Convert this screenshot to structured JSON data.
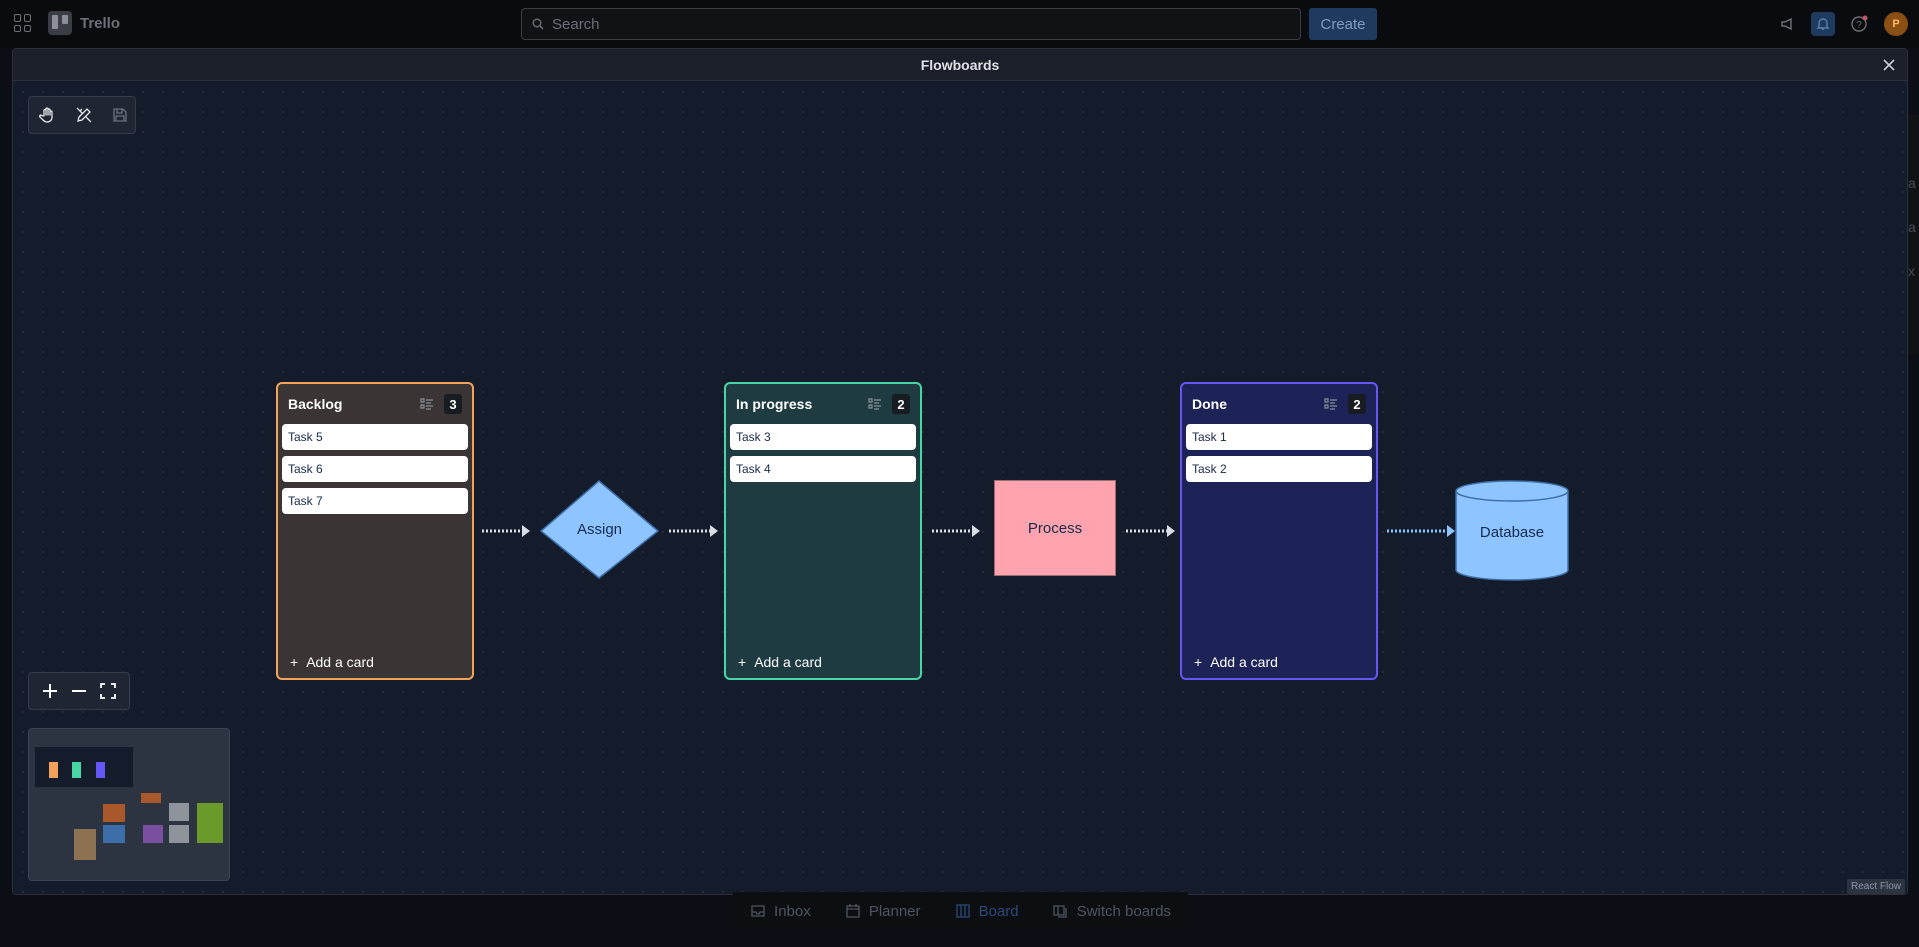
{
  "app": {
    "name": "Trello",
    "search_placeholder": "Search",
    "create_label": "Create",
    "avatar_initial": "P"
  },
  "modal": {
    "title": "Flowboards",
    "close_icon": "close-icon"
  },
  "toolbar": {
    "tools": [
      "hand-icon",
      "pen-ruler-icon",
      "save-icon"
    ]
  },
  "columns": [
    {
      "title": "Backlog",
      "count": "3",
      "cards": [
        "Task 5",
        "Task 6",
        "Task 7"
      ],
      "add_label": "Add a card",
      "color": "#f5a35b",
      "bg": "#3a3534"
    },
    {
      "title": "In progress",
      "count": "2",
      "cards": [
        "Task 3",
        "Task 4"
      ],
      "add_label": "Add a card",
      "color": "#49d6a5",
      "bg": "#1e3b42"
    },
    {
      "title": "Done",
      "count": "2",
      "cards": [
        "Task 1",
        "Task 2"
      ],
      "add_label": "Add a card",
      "color": "#6557f5",
      "bg": "#1d2257"
    }
  ],
  "shapes": {
    "assign": "Assign",
    "process": "Process",
    "database": "Database"
  },
  "attribution": "React Flow",
  "bottom_nav": {
    "inbox": "Inbox",
    "planner": "Planner",
    "board": "Board",
    "switch": "Switch boards"
  },
  "colors": {
    "assign_fill": "#8ec4ff",
    "process_fill": "#ffa4ae",
    "database_fill": "#8ec4ff"
  }
}
